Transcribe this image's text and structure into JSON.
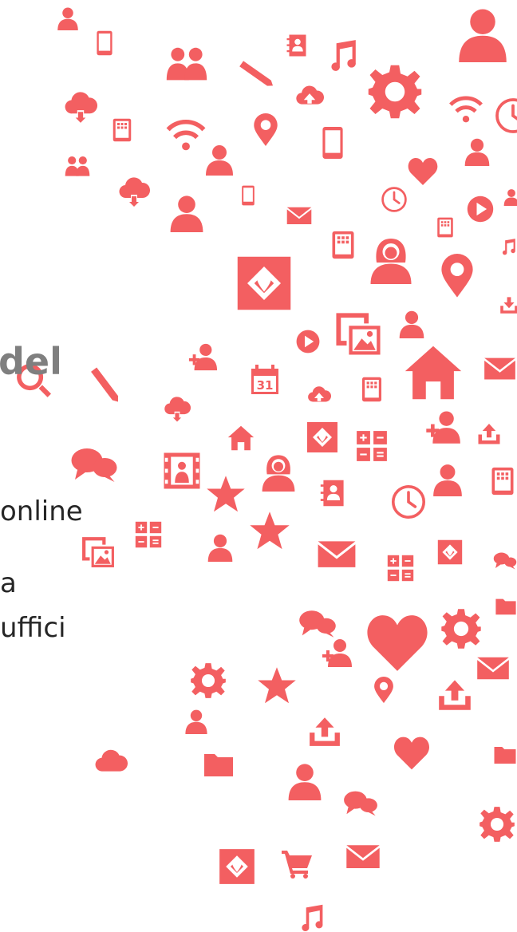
{
  "colors": {
    "icon": "#f35f61",
    "heading_text": "#7f7f7f",
    "body_text": "#262626",
    "background": "#ffffff"
  },
  "text": {
    "heading_fragment": "del",
    "line_1": "online",
    "line_2": "a",
    "line_3": "uffici"
  },
  "icons": [
    "person-icon",
    "smartphone-icon",
    "group-icon",
    "contact-book-icon",
    "music-note-icon",
    "person-icon",
    "pencil-icon",
    "cloud-upload-icon",
    "gear-icon",
    "wifi-icon",
    "clock-icon",
    "cloud-download-icon",
    "tablet-icon",
    "wifi-icon",
    "map-pin-icon",
    "smartphone-icon",
    "heart-icon",
    "group-icon",
    "person-icon",
    "person-icon",
    "cloud-download-icon",
    "person-icon",
    "smartphone-icon",
    "envelope-icon",
    "clock-icon",
    "tablet-icon",
    "play-button-icon",
    "person-icon",
    "tablet-icon",
    "map-icon",
    "woman-icon",
    "map-pin-icon",
    "music-note-icon",
    "download-icon",
    "play-button-icon",
    "image-gallery-icon",
    "person-icon",
    "person-add-icon",
    "magnifier-icon",
    "pencil-icon",
    "calendar-icon",
    "cloud-upload-icon",
    "tablet-icon",
    "home-icon",
    "envelope-icon",
    "cloud-download-icon",
    "home-icon",
    "map-icon",
    "calculator-icon",
    "person-add-icon",
    "upload-icon",
    "speech-bubbles-icon",
    "portrait-icon",
    "woman-icon",
    "star-icon",
    "contact-book-icon",
    "clock-icon",
    "person-icon",
    "tablet-icon",
    "image-gallery-icon",
    "calculator-icon",
    "star-icon",
    "person-icon",
    "envelope-icon",
    "calculator-icon",
    "map-icon",
    "speech-bubbles-icon",
    "speech-bubbles-icon",
    "heart-icon",
    "gear-icon",
    "folder-icon",
    "person-add-icon",
    "envelope-icon",
    "gear-icon",
    "star-icon",
    "map-pin-icon",
    "upload-icon",
    "person-icon",
    "upload-icon",
    "heart-icon",
    "cloud-icon",
    "folder-icon",
    "person-icon",
    "speech-bubbles-icon",
    "folder-icon",
    "gear-icon",
    "map-icon",
    "shopping-cart-icon",
    "envelope-icon",
    "music-note-icon"
  ]
}
